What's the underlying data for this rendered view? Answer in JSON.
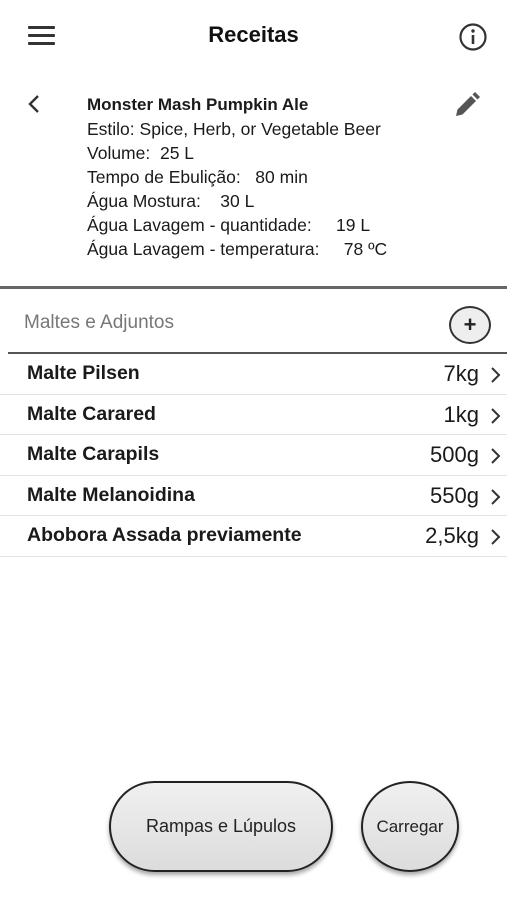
{
  "header": {
    "title": "Receitas",
    "menu_icon": "menu-icon",
    "info_icon": "info-icon"
  },
  "recipe": {
    "name": "Monster Mash Pumpkin Ale",
    "style": "Estilo: Spice, Herb, or Vegetable Beer",
    "volume": "Volume:  25 L",
    "boil_time": "Tempo de Ebulição:   80 min",
    "mash_water": "Água Mostura:    30 L",
    "sparge_quantity": "Água Lavagem - quantidade:     19 L",
    "sparge_temperature": "Água Lavagem - temperatura:     78 ºC",
    "back_icon": "chevron-left-icon",
    "edit_icon": "pencil-icon"
  },
  "malts": {
    "header": "Maltes e Adjuntos",
    "add_label": "+",
    "items": [
      {
        "name": "Malte Pilsen",
        "qty": "7kg"
      },
      {
        "name": "Malte Carared",
        "qty": "1kg"
      },
      {
        "name": "Malte Carapils",
        "qty": "500g"
      },
      {
        "name": "Malte Melanoidina",
        "qty": "550g"
      },
      {
        "name": "Abobora Assada previamente",
        "qty": "2,5kg"
      }
    ]
  },
  "buttons": {
    "rampas": "Rampas e Lúpulos",
    "carregar": "Carregar"
  },
  "colors": {
    "divider": "#666666",
    "button_fill": "#e6e6e6",
    "section_text": "#777777"
  }
}
